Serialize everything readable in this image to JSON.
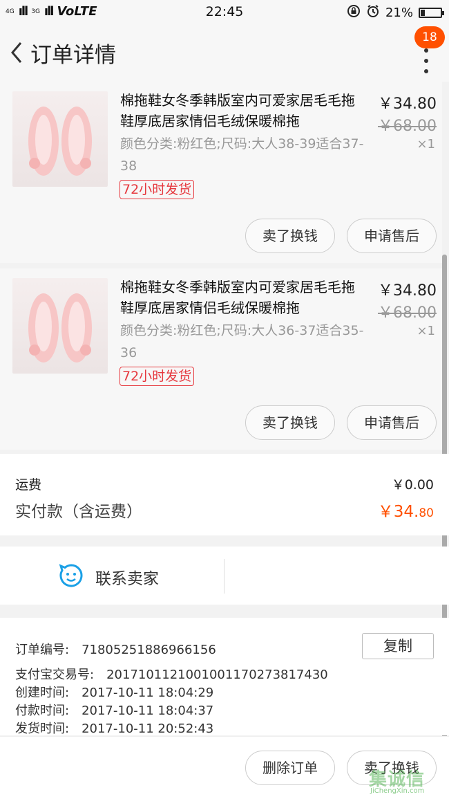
{
  "status_bar": {
    "sig1": "4G",
    "sig2": "3G",
    "volte": "VoLTE",
    "time": "22:45",
    "battery": "21%",
    "battery_level": 0.21
  },
  "header": {
    "title": "订单详情",
    "badge": "18"
  },
  "items": [
    {
      "title": "棉拖鞋女冬季韩版室内可爱家居毛毛拖鞋厚底居家情侣毛绒保暖棉拖",
      "sku": "颜色分类:粉红色;尺码:大人38-39适合37-38",
      "tag": "72小时发货",
      "price": "￥34.80",
      "old_price": "￥68.00",
      "qty": "×1",
      "btn_sell": "卖了换钱",
      "btn_after_sale": "申请售后"
    },
    {
      "title": "棉拖鞋女冬季韩版室内可爱家居毛毛拖鞋厚底居家情侣毛绒保暖棉拖",
      "sku": "颜色分类:粉红色;尺码:大人36-37适合35-36",
      "tag": "72小时发货",
      "price": "￥34.80",
      "old_price": "￥68.00",
      "qty": "×1",
      "btn_sell": "卖了换钱",
      "btn_after_sale": "申请售后"
    }
  ],
  "fee": {
    "shipping_label": "运费",
    "shipping_value": "￥0.00",
    "paid_label": "实付款（含运费）",
    "paid_main": "￥34.",
    "paid_cents": "80"
  },
  "contact": {
    "label": "联系卖家"
  },
  "info": {
    "order_no_label": "订单编号:",
    "order_no": "71805251886966156",
    "copy_label": "复制",
    "alipay_label": "支付宝交易号:",
    "alipay_no": "2017101121001001170273817430",
    "created_label": "创建时间:",
    "created": "2017-10-11  18:04:29",
    "paid_label": "付款时间:",
    "paid": "2017-10-11  18:04:37",
    "shipped_label": "发货时间:",
    "shipped": "2017-10-11  20:52:43"
  },
  "footer": {
    "delete_label": "删除订单",
    "sell_label": "卖了换钱"
  },
  "watermark": {
    "logo": "集诚信",
    "url": "JiChengXin.com"
  },
  "colors": {
    "accent": "#ff5000",
    "tag_red": "#e6383e"
  }
}
